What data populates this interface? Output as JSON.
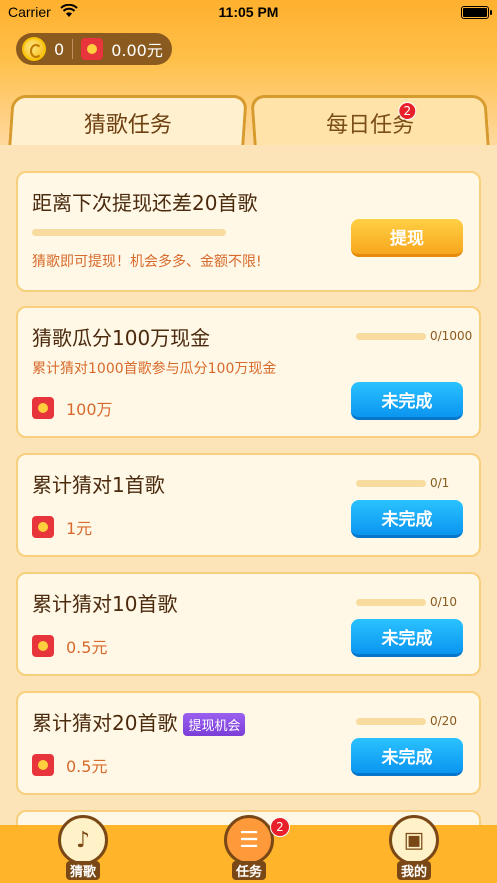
{
  "status_bar": {
    "carrier": "Carrier",
    "time": "11:05 PM"
  },
  "wallet": {
    "coins": "0",
    "cash": "0.00元"
  },
  "tabs": [
    {
      "label": "猜歌任务",
      "active": true
    },
    {
      "label": "每日任务",
      "badge": "2"
    }
  ],
  "withdraw_card": {
    "title": "距离下次提现还差20首歌",
    "desc": "猜歌即可提现！机会多多、金额不限!",
    "button": "提现"
  },
  "tasks": [
    {
      "title": "猜歌瓜分100万现金",
      "progress": "0/1000",
      "desc": "累计猜对1000首歌参与瓜分100万现金",
      "reward": "100万",
      "button": "未完成"
    },
    {
      "title": "累计猜对1首歌",
      "progress": "0/1",
      "reward": "1元",
      "button": "未完成"
    },
    {
      "title": "累计猜对10首歌",
      "progress": "0/10",
      "reward": "0.5元",
      "button": "未完成"
    },
    {
      "title": "累计猜对20首歌",
      "tag": "提现机会",
      "progress": "0/20",
      "reward": "0.5元",
      "button": "未完成"
    }
  ],
  "bottom_nav": [
    {
      "label": "猜歌",
      "icon": "music-note-icon"
    },
    {
      "label": "任务",
      "icon": "task-list-icon",
      "badge": "2"
    },
    {
      "label": "我的",
      "icon": "wallet-icon"
    }
  ]
}
